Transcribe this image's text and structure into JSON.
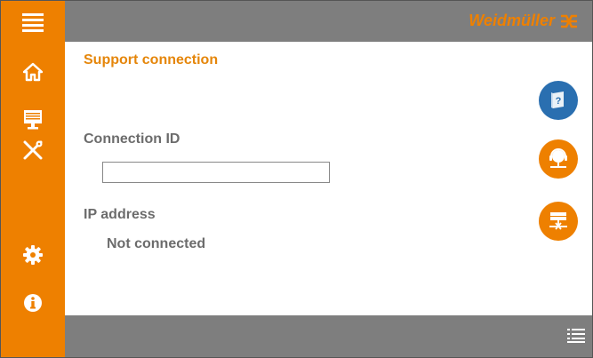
{
  "header": {
    "brand_name": "Weidmüller",
    "logo_icon": "weidmuller-logo-icon"
  },
  "sidebar": {
    "items": [
      {
        "name": "menu",
        "icon": "hamburger-menu-icon"
      },
      {
        "name": "home",
        "icon": "home-icon"
      },
      {
        "name": "monitor",
        "icon": "monitor-icon"
      },
      {
        "name": "tools",
        "icon": "wrench-screwdriver-icon"
      },
      {
        "name": "settings",
        "icon": "gear-icon"
      },
      {
        "name": "info",
        "icon": "info-icon"
      }
    ]
  },
  "main": {
    "title": "Support connection",
    "connection_id": {
      "label": "Connection ID",
      "value": "",
      "placeholder": ""
    },
    "ip_address": {
      "label": "IP address",
      "value": "Not connected"
    }
  },
  "actions": [
    {
      "name": "manual",
      "icon": "book-question-icon",
      "color": "#2a6fb0"
    },
    {
      "name": "support",
      "icon": "headset-network-icon",
      "color": "#ee8000"
    },
    {
      "name": "network",
      "icon": "server-network-icon",
      "color": "#ee8000"
    }
  ],
  "footer": {
    "menu_icon": "list-menu-icon"
  },
  "colors": {
    "accent": "#ee8000",
    "bar": "#7e7e7e",
    "blue": "#2a6fb0"
  }
}
